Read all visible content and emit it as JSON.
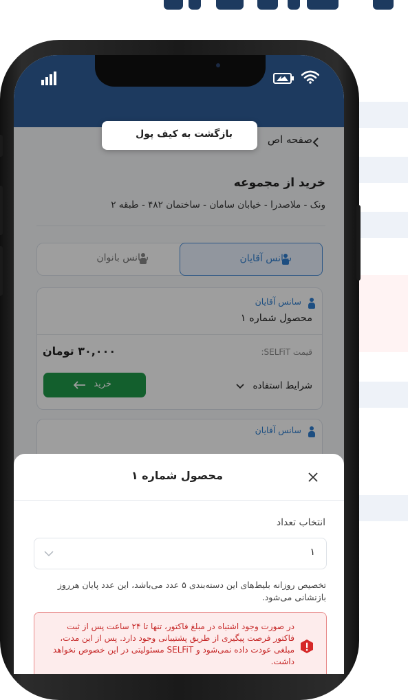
{
  "colors": {
    "navy": "#1d3a5f",
    "accent_blue": "#2f7fd1",
    "buy_green": "#1f9a4a",
    "alert_red": "#d62828",
    "alert_bg": "#fdecec"
  },
  "status_bar": {
    "signal_icon": "signal-bars-icon",
    "battery_icon": "battery-icon",
    "wifi_icon": "wifi-icon"
  },
  "breadcrumb": {
    "label": "صفحه اص",
    "chevron_icon": "chevron-left-icon"
  },
  "tooltip": {
    "label": "بازگشت به کیف پول"
  },
  "venue": {
    "title": "خرید از مجموعه",
    "address": "ونک - ملاصدرا - خیابان سامان - ساختمان ۴۸۲ - طبقه ۲"
  },
  "tabs": [
    {
      "label": "سانس آقایان",
      "active": true
    },
    {
      "label": "سانس بانوان",
      "active": false
    }
  ],
  "product_card": {
    "session_label": "سانس آقایان",
    "product_name": "محصول شماره ۱",
    "price_label": "قیمت SELFiT:",
    "price_value": "۳۰,۰۰۰ تومان",
    "terms_label": "شرایط استفاده",
    "buy_label": "خرید"
  },
  "second_card": {
    "session_label": "سانس آقایان"
  },
  "sheet": {
    "title": "محصول شماره ۱",
    "quantity_label": "انتخاب تعداد",
    "quantity_value": "۱",
    "note": "تخصیص روزانه بلیط‌های این دسته‌بندی ۵ عدد می‌باشد، این عدد پایان هرروز بازنشانی می‌شود.",
    "alert": "در صورت وجود اشتباه در مبلغ فاکتور، تنها تا ۲۴ ساعت پس از ثبت فاکتور فرصت پیگیری از طریق پشتیبانی وجود دارد. پس از این مدت، مبلغی عودت داده نمی‌شود و SELFiT مسئولیتی در این خصوص نخواهد داشت."
  }
}
